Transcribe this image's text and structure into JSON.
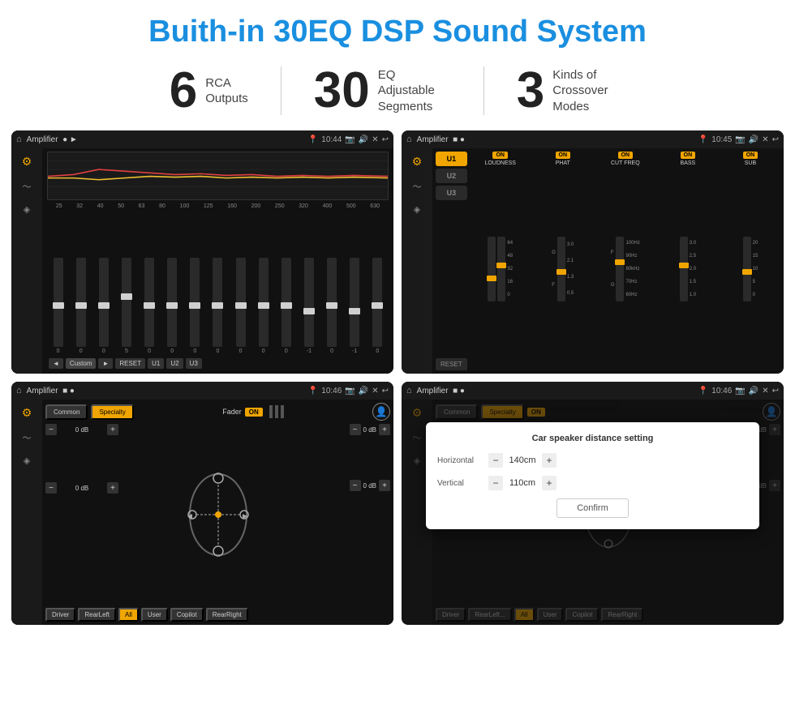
{
  "page": {
    "title": "Buith-in 30EQ DSP Sound System"
  },
  "stats": [
    {
      "number": "6",
      "text_line1": "RCA",
      "text_line2": "Outputs"
    },
    {
      "divider": true
    },
    {
      "number": "30",
      "text_line1": "EQ Adjustable",
      "text_line2": "Segments"
    },
    {
      "divider": true
    },
    {
      "number": "3",
      "text_line1": "Kinds of",
      "text_line2": "Crossover Modes"
    }
  ],
  "screens": {
    "eq": {
      "topbar": {
        "title": "Amplifier",
        "time": "10:44"
      },
      "freq_labels": [
        "25",
        "32",
        "40",
        "50",
        "63",
        "80",
        "100",
        "125",
        "160",
        "200",
        "250",
        "320",
        "400",
        "500",
        "630"
      ],
      "slider_values": [
        "0",
        "0",
        "0",
        "5",
        "0",
        "0",
        "0",
        "0",
        "0",
        "0",
        "0",
        "-1",
        "0",
        "-1"
      ],
      "bottom_buttons": [
        "◄",
        "Custom",
        "►",
        "RESET",
        "U1",
        "U2",
        "U3"
      ]
    },
    "crossover": {
      "topbar": {
        "title": "Amplifier",
        "time": "10:45"
      },
      "u_buttons": [
        "U1",
        "U2",
        "U3"
      ],
      "channels": [
        {
          "label": "LOUDNESS",
          "on": true
        },
        {
          "label": "PHAT",
          "on": true
        },
        {
          "label": "CUT FREQ",
          "on": true
        },
        {
          "label": "BASS",
          "on": true
        },
        {
          "label": "SUB",
          "on": true
        }
      ],
      "reset_btn": "RESET"
    },
    "fader": {
      "topbar": {
        "title": "Amplifier",
        "time": "10:46"
      },
      "tabs": [
        "Common",
        "Specialty"
      ],
      "fader_label": "Fader",
      "fader_on": "ON",
      "db_controls": [
        {
          "value": "0 dB"
        },
        {
          "value": "0 dB"
        },
        {
          "value": "0 dB"
        },
        {
          "value": "0 dB"
        }
      ],
      "bottom_buttons": [
        "Driver",
        "RearLeft",
        "All",
        "User",
        "Copilot",
        "RearRight"
      ]
    },
    "distance": {
      "topbar": {
        "title": "Amplifier",
        "time": "10:46"
      },
      "tabs": [
        "Common",
        "Specialty"
      ],
      "overlay_title": "Car speaker distance setting",
      "horizontal_label": "Horizontal",
      "horizontal_value": "140cm",
      "vertical_label": "Vertical",
      "vertical_value": "110cm",
      "confirm_btn": "Confirm",
      "db_values": [
        "0 dB",
        "0 dB"
      ]
    }
  }
}
